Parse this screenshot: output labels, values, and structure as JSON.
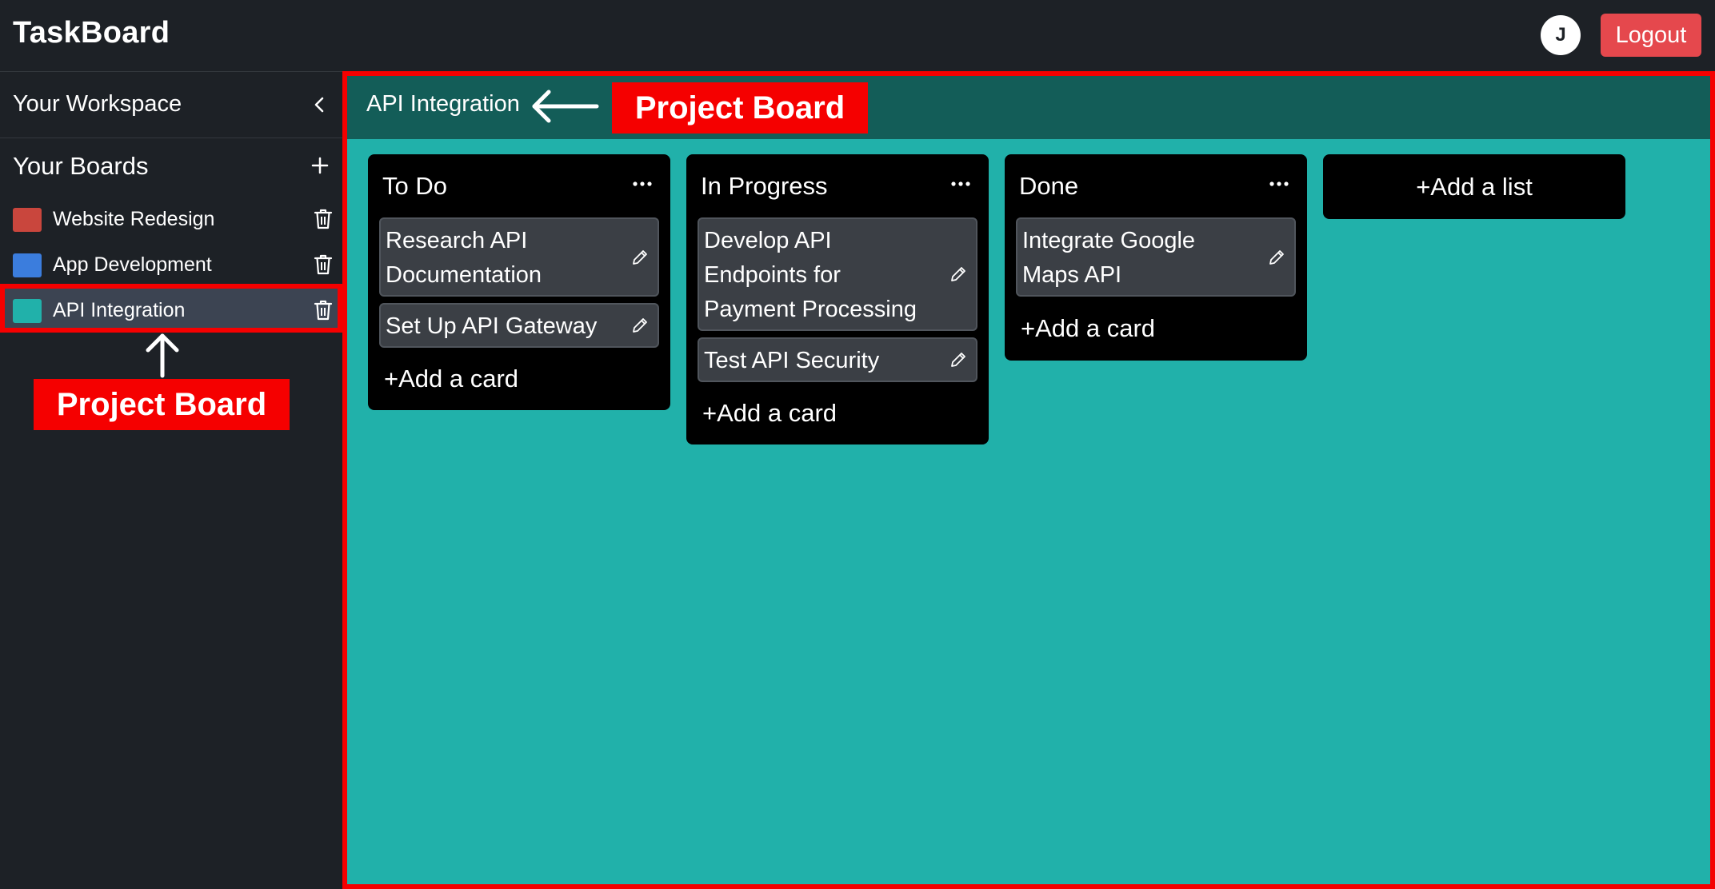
{
  "app": {
    "title": "TaskBoard"
  },
  "header": {
    "avatar_initial": "J",
    "logout_label": "Logout"
  },
  "sidebar": {
    "workspace_title": "Your Workspace",
    "boards_title": "Your Boards",
    "boards": [
      {
        "label": "Website Redesign",
        "color": "#c9463d",
        "active": false
      },
      {
        "label": "App Development",
        "color": "#3b7ddd",
        "active": false
      },
      {
        "label": "API Integration",
        "color": "#21b1aa",
        "active": true
      }
    ]
  },
  "board": {
    "name": "API Integration",
    "background_color": "#21b1aa",
    "header_color": "#135d58",
    "lists": [
      {
        "title": "To Do",
        "cards": [
          "Research API Documentation",
          "Set Up API Gateway"
        ],
        "add_card_label": "+Add a card"
      },
      {
        "title": "In Progress",
        "cards": [
          "Develop API Endpoints for Payment Processing",
          "Test API Security"
        ],
        "add_card_label": "+Add a card"
      },
      {
        "title": "Done",
        "cards": [
          "Integrate Google Maps API"
        ],
        "add_card_label": "+Add a card"
      }
    ],
    "add_list_label": "+Add a list"
  },
  "annotations": {
    "header_label": "Project Board",
    "sidebar_label": "Project Board",
    "color": "#f50000"
  },
  "icons": {
    "collapse": "chevron-left-icon",
    "add_board": "plus-icon",
    "delete_board": "trash-icon",
    "list_menu": "ellipsis-icon",
    "edit_card": "pencil-icon"
  }
}
